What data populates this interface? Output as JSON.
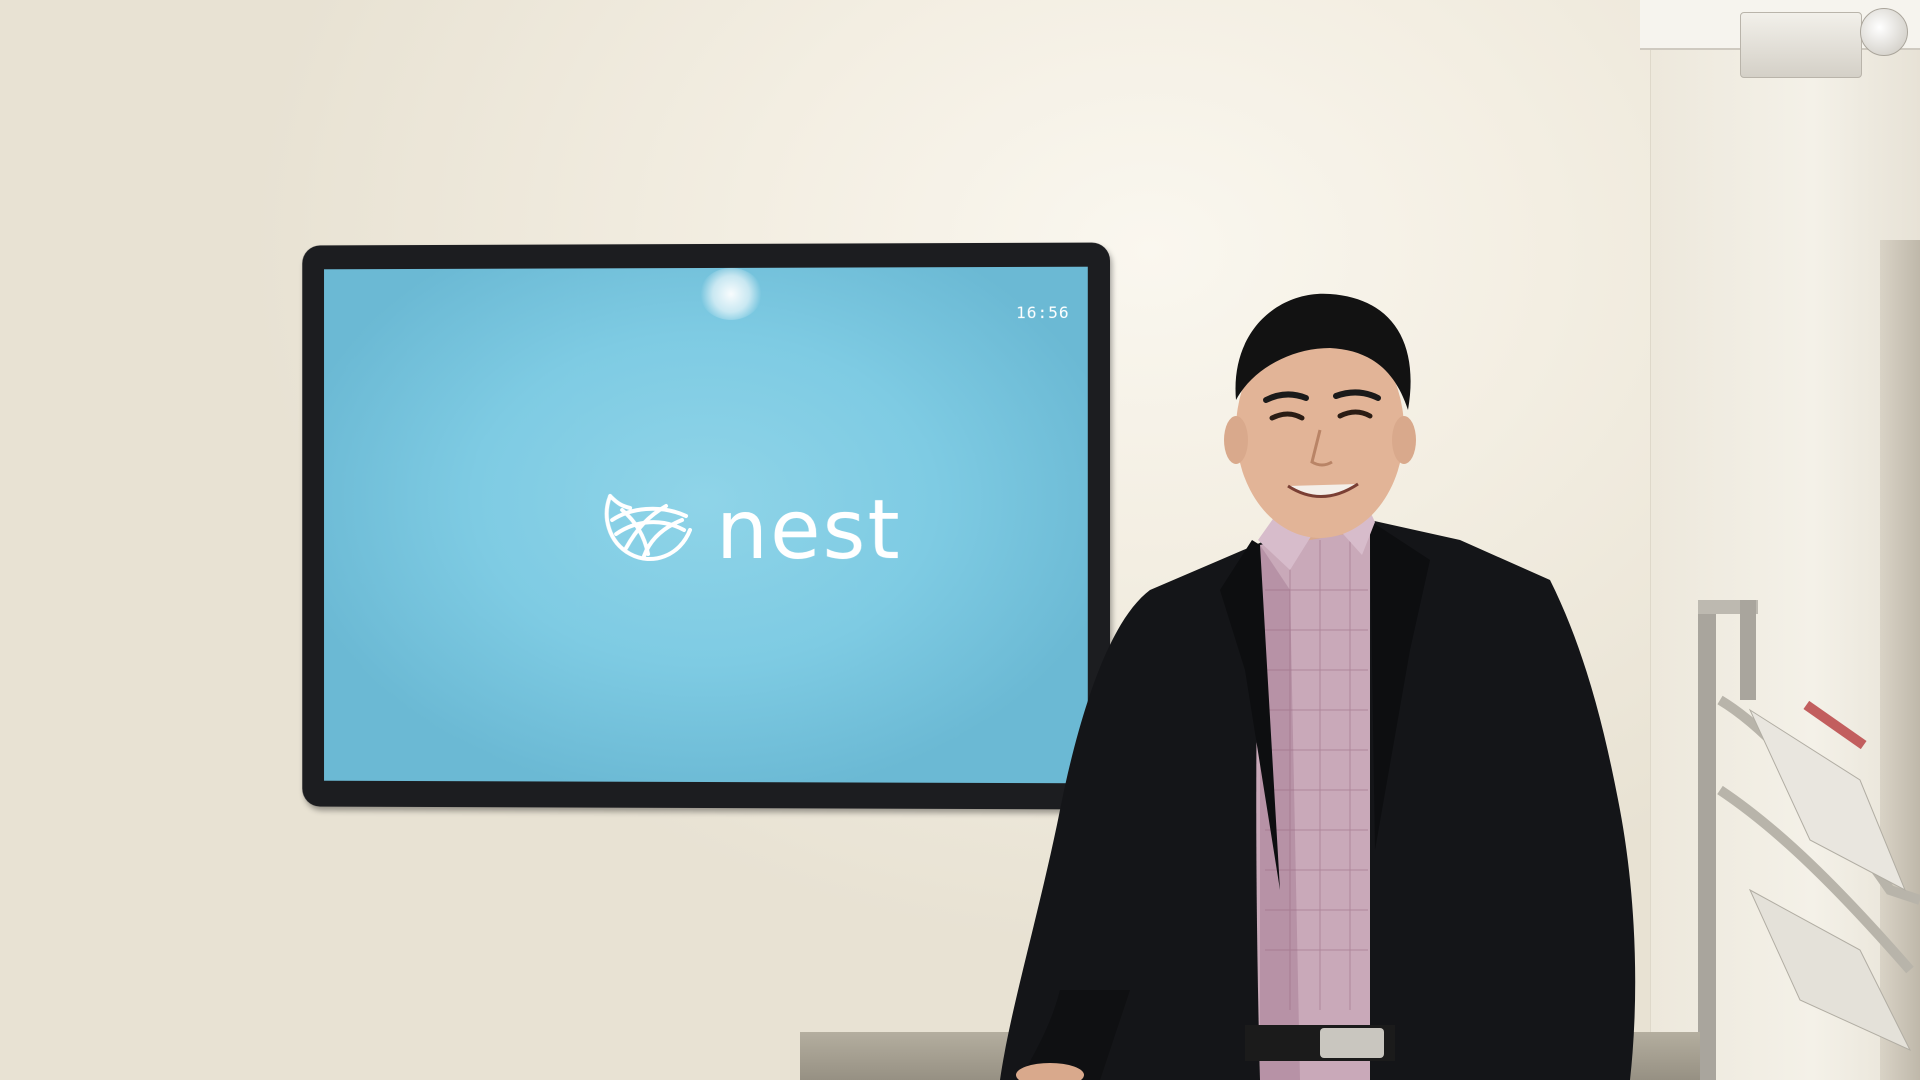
{
  "screen": {
    "clock": "16:56",
    "logo_text": "nest"
  },
  "colors": {
    "screen_blue": "#7ecbe3",
    "wall": "#f3eee2",
    "bezel": "#1c1d20",
    "jacket": "#141518",
    "shirt": "#c9a9b9"
  },
  "icons": {
    "logo": "nest-logo-icon"
  }
}
